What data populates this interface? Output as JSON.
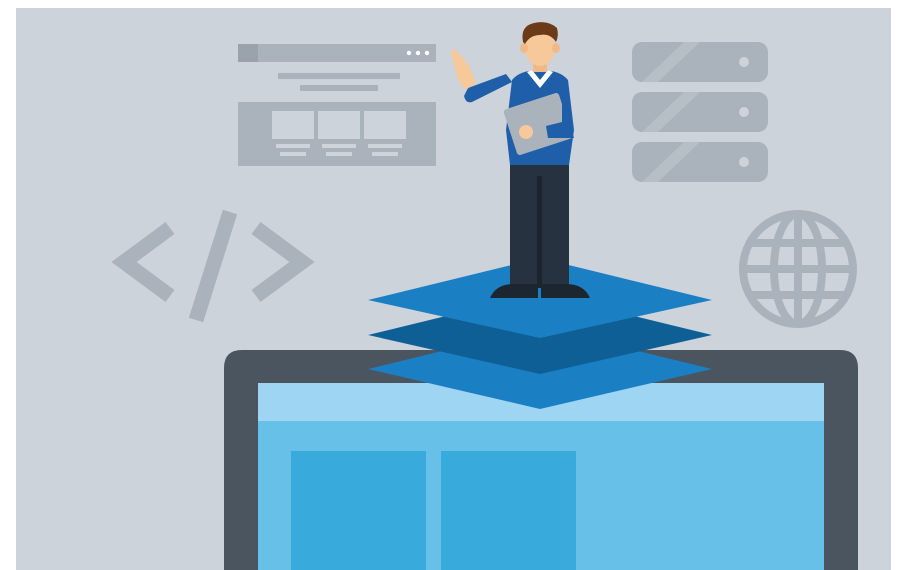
{
  "illustration": {
    "subject": "developer-standing-on-layer-stack",
    "icons": [
      "browser-window-icon",
      "code-tag-icon",
      "server-stack-icon",
      "globe-icon",
      "layers-icon",
      "monitor"
    ],
    "colors": {
      "background": "#ccd3db",
      "icon_gray": "#aab3bb",
      "icon_dark": "#9aa3ab",
      "monitor_frame": "#4a5560",
      "screen_top": "#9ed5f2",
      "screen_body": "#67c0e8",
      "screen_panel": "#38aadb",
      "layer_light": "#1b7fc4",
      "layer_dark": "#0f5f97",
      "shirt": "#1f5ea8",
      "pants": "#26323f",
      "skin": "#f6c89a",
      "hair": "#6b3a16",
      "collar": "#ffffff"
    }
  }
}
